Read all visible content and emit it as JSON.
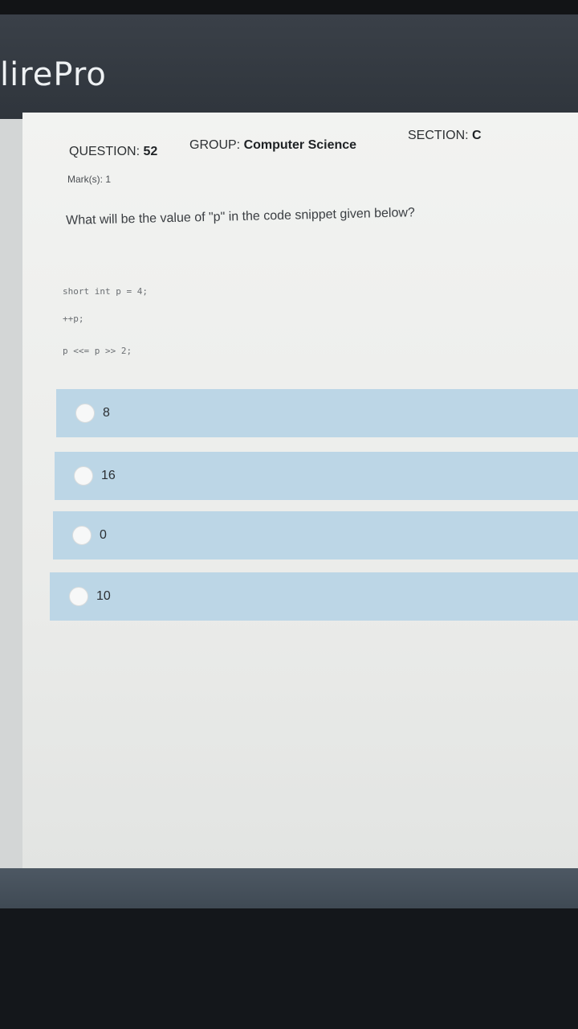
{
  "app": {
    "logo_text": "lirePro"
  },
  "question": {
    "number_label": "QUESTION:",
    "number_value": "52",
    "group_label": "GROUP:",
    "group_value": "Computer Science",
    "section_label": "SECTION:",
    "section_value": "C",
    "marks_text": "Mark(s): 1",
    "prompt": "What will be the value of \"p\" in the code snippet given below?",
    "code_lines": [
      "short int p = 4;",
      "++p;",
      "p <<= p >> 2;"
    ]
  },
  "options": [
    {
      "label": "8"
    },
    {
      "label": "16"
    },
    {
      "label": "0"
    },
    {
      "label": "10"
    }
  ],
  "colors": {
    "header_bg": "#2f353c",
    "option_bg": "#bcd6e6",
    "panel_bg": "#f2f3f1"
  }
}
